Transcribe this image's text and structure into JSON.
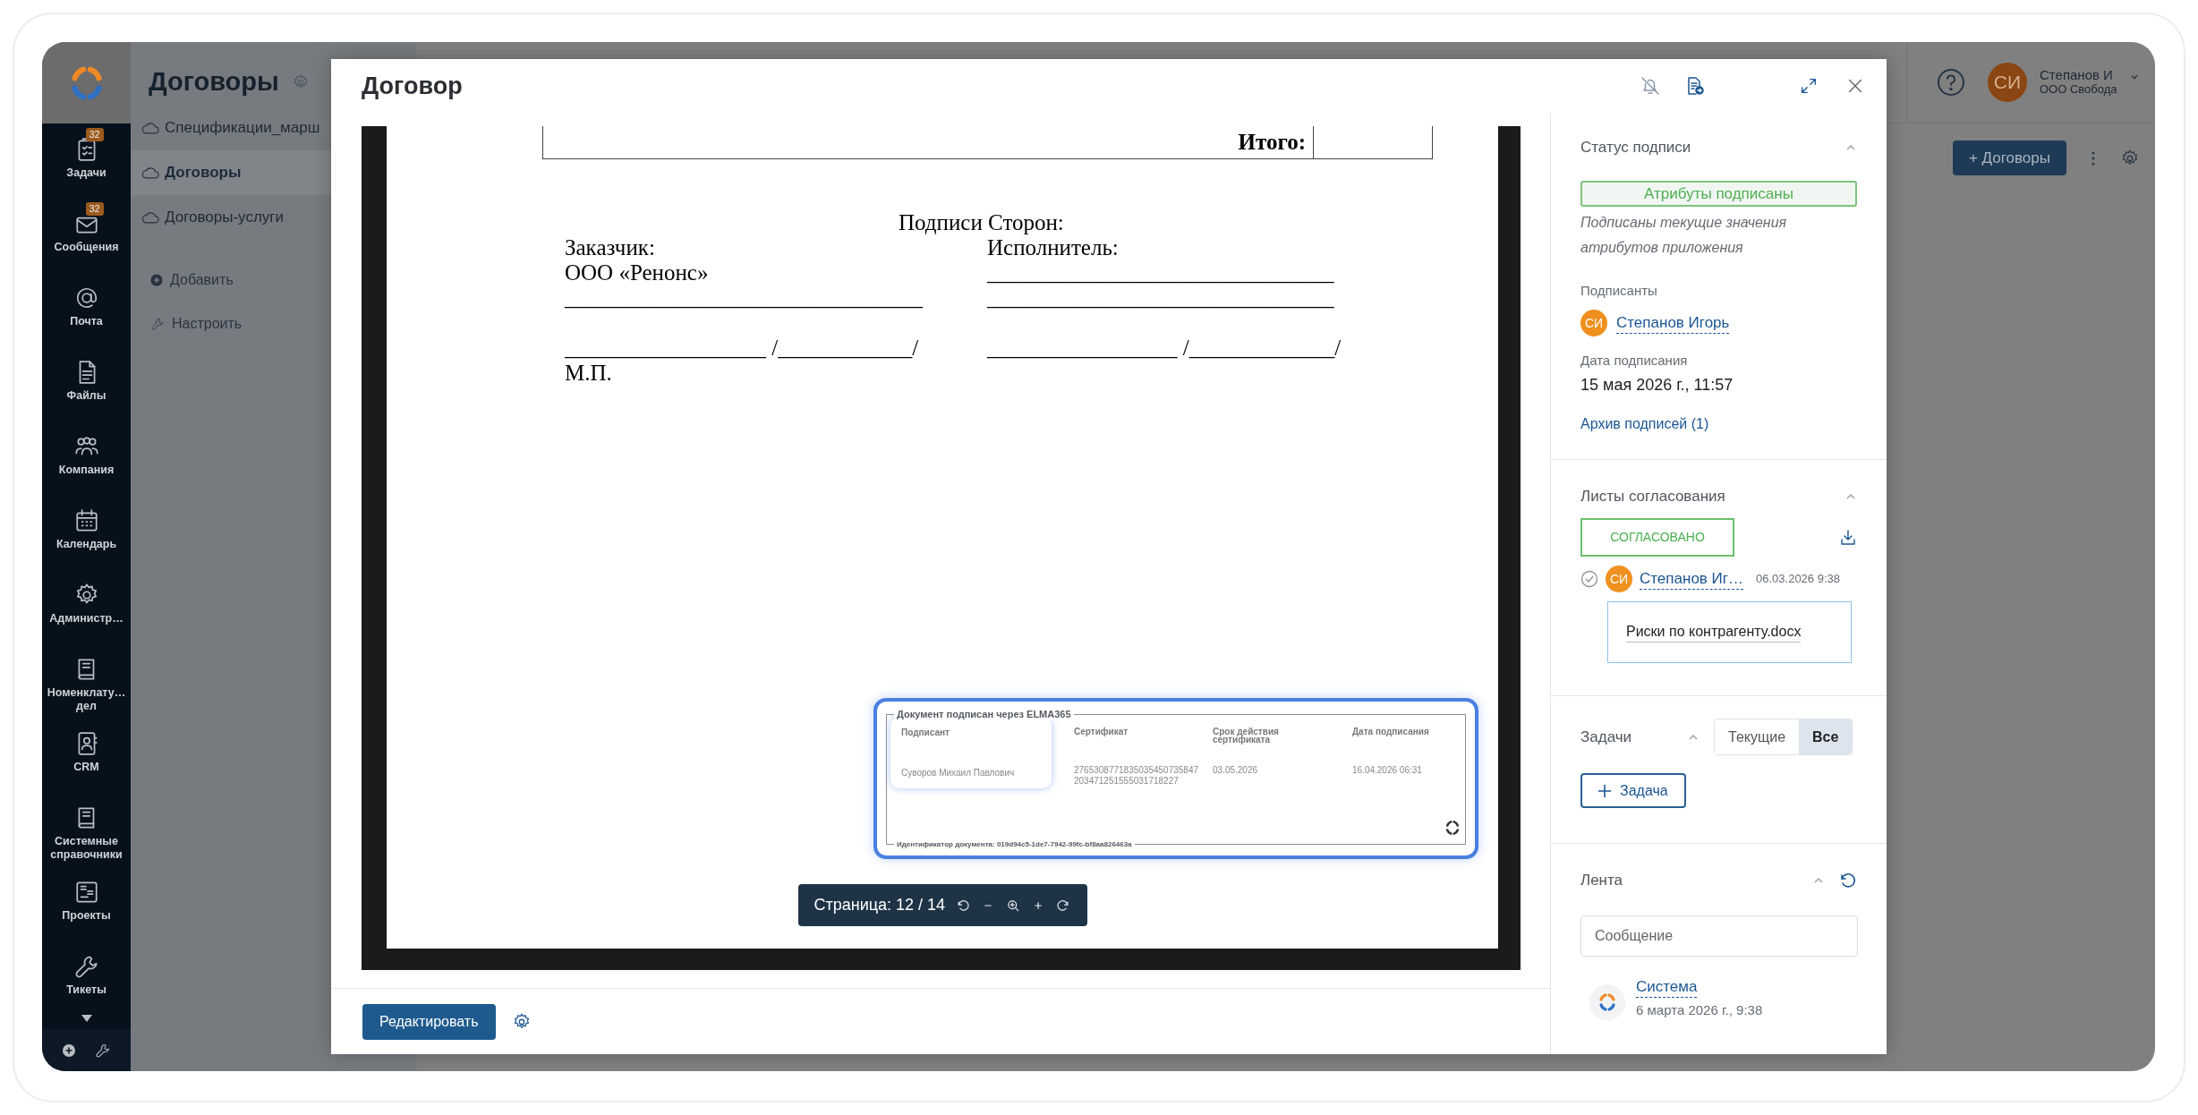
{
  "nav": {
    "items": [
      {
        "label": "Задачи",
        "badge": "32"
      },
      {
        "label": "Сообщения",
        "badge": "32"
      },
      {
        "label": "Почта"
      },
      {
        "label": "Файлы"
      },
      {
        "label": "Компания"
      },
      {
        "label": "Календарь"
      },
      {
        "label": "Администр…"
      },
      {
        "label": "Номенклату… дел"
      },
      {
        "label": "CRM"
      },
      {
        "label": "Системные справочники"
      },
      {
        "label": "Проекты"
      },
      {
        "label": "Тикеты"
      }
    ]
  },
  "workspace": {
    "title": "Договоры",
    "sections": [
      {
        "label": "Спецификации_марш",
        "selected": false
      },
      {
        "label": "Договоры",
        "selected": true
      },
      {
        "label": "Договоры-услуги",
        "selected": false
      }
    ],
    "actions": [
      {
        "label": "Добавить",
        "kind": "add"
      },
      {
        "label": "Настроить",
        "kind": "configure"
      }
    ]
  },
  "header": {
    "user_initials": "СИ",
    "user_name": "Степанов И",
    "organization": "ООО Свобода",
    "create_button": "+ Договоры"
  },
  "modal": {
    "title": "Договор",
    "document": {
      "total_label": "Итого:",
      "heading": "Подписи Сторон:",
      "parties": [
        {
          "label": "Заказчик:",
          "lines": [
            "ООО «Ренонс»",
            "________________________________"
          ],
          "signature_line": "__________________ /____________/",
          "note": "М.П."
        },
        {
          "label": "Исполнитель:",
          "lines": [
            "_______________________________",
            "_______________________________"
          ],
          "signature_line": "_________________ /_____________/"
        }
      ],
      "stamp": {
        "title": "Документ подписан через ELMA365",
        "columns": [
          "Подписант",
          "Сертификат",
          "Срок действия сертификата",
          "Дата подписания"
        ],
        "values": [
          "Суворов Михаил Павлович",
          "2765308771835035450735847203471251555031718227",
          "03.05.2026",
          "16.04.2026 06:31"
        ],
        "document_id": "Идентификатор документа: 019d94c5-1de7-7942-99fc-bf8aa826463a"
      }
    },
    "page_toolbar": {
      "label": "Страница: 12 / 14"
    },
    "footer": {
      "edit_button": "Редактировать"
    },
    "panel": {
      "signature_status": {
        "title": "Статус подписи",
        "expanded": true,
        "badge": "Атрибуты подписаны",
        "note": "Подписаны текущие значения атрибутов приложения",
        "signers_label": "Подписанты",
        "signers": [
          {
            "initials": "СИ",
            "name": "Степанов Игорь"
          }
        ],
        "date_label": "Дата подписания",
        "date": "15 мая 2026 г., 11:57",
        "archive_link": "Архив подписей (1)"
      },
      "approval_sheets": {
        "title": "Листы согласования",
        "expanded": true,
        "status": "СОГЛАСОВАНО",
        "entries": [
          {
            "approved": true,
            "initials": "СИ",
            "name": "Степанов Иг…",
            "time": "06.03.2026 9:38",
            "attachment": "Риски по контрагенту.docx"
          }
        ]
      },
      "tasks": {
        "title": "Задачи",
        "expanded": true,
        "filters": [
          {
            "label": "Текущие",
            "selected": false
          },
          {
            "label": "Все",
            "selected": true
          }
        ],
        "add_button": "Задача"
      },
      "feed": {
        "title": "Лента",
        "expanded": true,
        "placeholder": "Сообщение",
        "entries": [
          {
            "author": "Система",
            "time": "6 марта 2026 г., 9:38"
          }
        ]
      }
    }
  }
}
